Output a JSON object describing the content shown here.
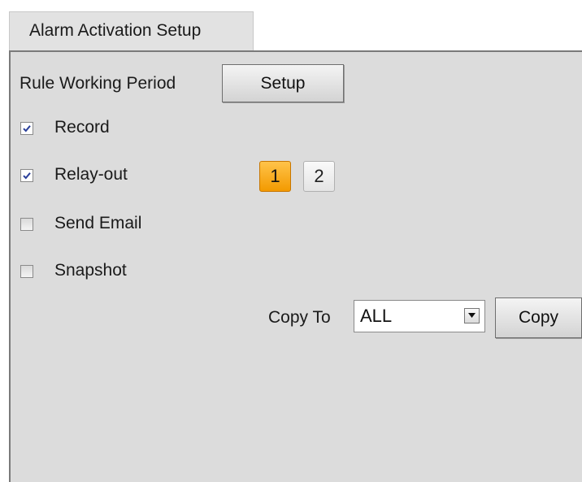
{
  "tab": {
    "title": "Alarm Activation Setup"
  },
  "rule_working_period": {
    "label": "Rule Working Period",
    "button_label": "Setup"
  },
  "actions": [
    {
      "label": "Record",
      "checked": true
    },
    {
      "label": "Relay-out",
      "checked": true
    },
    {
      "label": "Send Email",
      "checked": false
    },
    {
      "label": "Snapshot",
      "checked": false
    }
  ],
  "relays": [
    {
      "label": "1",
      "active": true
    },
    {
      "label": "2",
      "active": false
    }
  ],
  "copy": {
    "label": "Copy To",
    "selected": "ALL",
    "button_label": "Copy"
  },
  "colors": {
    "panel_bg": "#dcdcdc",
    "relay_active": "#f7a414",
    "checkmark": "#2a3f9a"
  }
}
